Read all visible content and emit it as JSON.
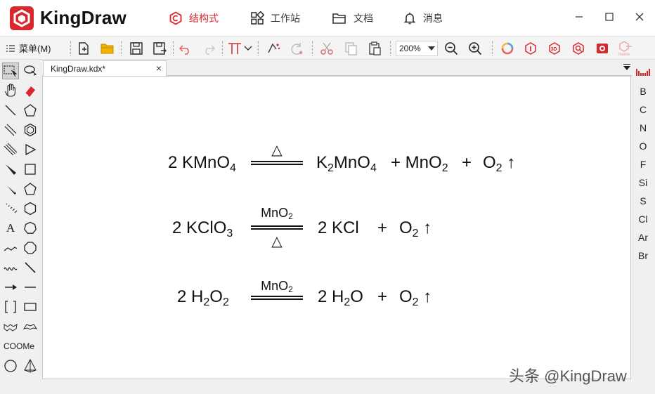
{
  "app": {
    "name": "KingDraw",
    "brand_color": "#d9272e",
    "nav_tabs": [
      {
        "label": "结构式",
        "icon": "hexagon-structure-icon",
        "active": true
      },
      {
        "label": "工作站",
        "icon": "grid-workstation-icon",
        "active": false
      },
      {
        "label": "文档",
        "icon": "folder-documents-icon",
        "active": false
      },
      {
        "label": "消息",
        "icon": "bell-messages-icon",
        "active": false
      }
    ],
    "window_controls": [
      "minimize-icon",
      "maximize-icon",
      "close-icon"
    ]
  },
  "toolbar": {
    "menu_label": "菜单(M)",
    "zoom_value": "200%",
    "tools": [
      "new-file-icon",
      "open-folder-icon",
      "save-icon",
      "save-as-icon",
      "undo-icon",
      "redo-icon",
      "text-tool-icon",
      "chevron-down-icon",
      "clean-structure-icon",
      "rotate-icon",
      "cut-icon",
      "copy-icon",
      "paste-icon",
      "zoom-out-icon",
      "zoom-in-icon",
      "color-ring-icon",
      "info-icon",
      "3d-view-icon",
      "search-molecule-icon",
      "image-recognition-icon",
      "name-to-structure-icon"
    ]
  },
  "document": {
    "tab_title": "KingDraw.kdx*",
    "close_symbol": "×"
  },
  "left_tools": {
    "text_tool_label": "A",
    "coome_label": "COOMe"
  },
  "elements": [
    "B",
    "C",
    "N",
    "O",
    "F",
    "Si",
    "S",
    "Cl",
    "Ar",
    "Br"
  ],
  "equations": {
    "eq1": {
      "coef": "2 KMnO",
      "coef_sub": "4",
      "above": "△",
      "p1": "K",
      "p1_sub": "2",
      "p1b": "MnO",
      "p1b_sub": "4",
      "plus1": "+ MnO",
      "plus1_sub": "2",
      "plus2": "+",
      "o2": "O",
      "o2_sub": "2",
      "arrow": "↑"
    },
    "eq2": {
      "coef": "2 KClO",
      "coef_sub": "3",
      "above": "MnO",
      "above_sub": "2",
      "below": "△",
      "p1": "2 KCl",
      "plus1": "+",
      "o2": "O",
      "o2_sub": "2",
      "arrow": "↑"
    },
    "eq3": {
      "coef": "2 H",
      "coef_sub": "2",
      "coef_b": "O",
      "coef_b_sub": "2",
      "above": "MnO",
      "above_sub": "2",
      "p1": "2 H",
      "p1_sub": "2",
      "p1b": "O",
      "plus1": "+",
      "o2": "O",
      "o2_sub": "2",
      "arrow": "↑"
    }
  },
  "watermark": "头条 @KingDraw"
}
